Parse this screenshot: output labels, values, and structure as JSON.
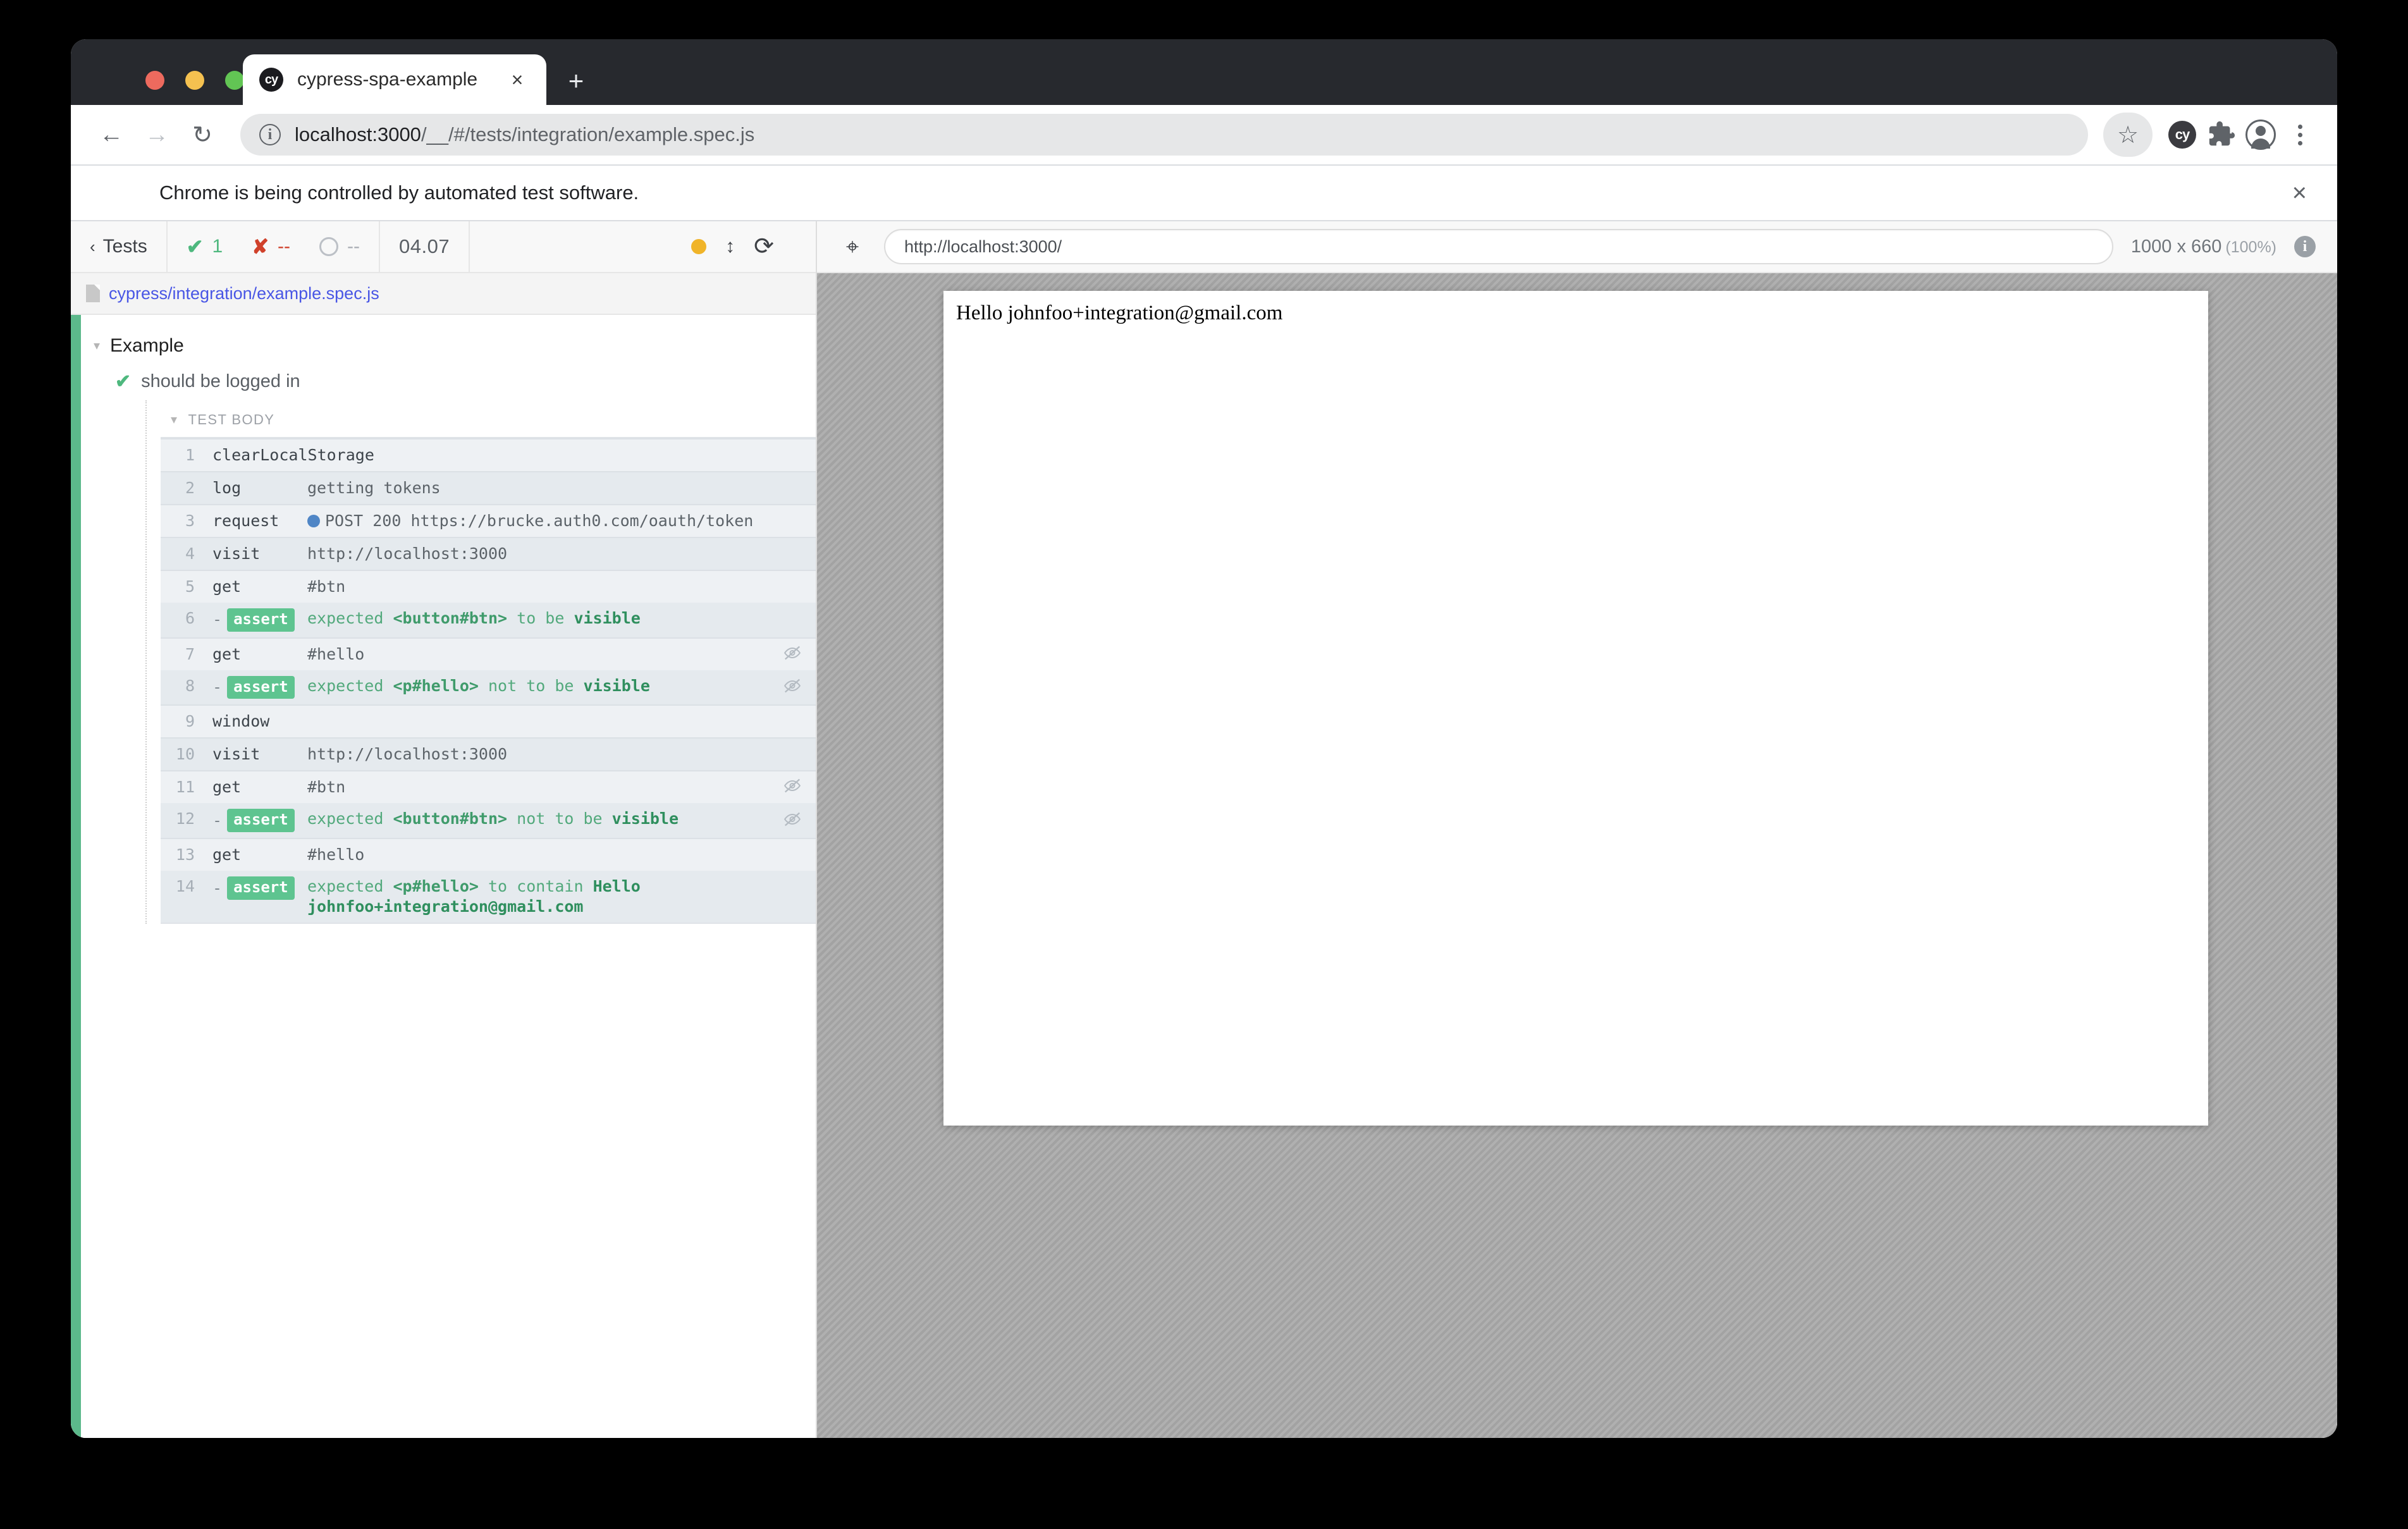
{
  "browser": {
    "tab": {
      "title": "cypress-spa-example",
      "favicon_text": "cy",
      "close_label": "×"
    },
    "new_tab_label": "+",
    "nav": {
      "back": "←",
      "forward": "→",
      "reload": "↻"
    },
    "omnibox": {
      "url_prefix": "localhost:3000",
      "url_rest": "/__/#/tests/integration/example.spec.js",
      "full_url": "localhost:3000/__/#/tests/integration/example.spec.js",
      "star_label": "☆"
    },
    "extensions": {
      "cypress_label": "cy",
      "puzzle_label": "❖"
    },
    "infobar": {
      "text": "Chrome is being controlled by automated test software.",
      "close_label": "×"
    }
  },
  "reporter": {
    "back_to_tests": "Tests",
    "back_chevron": "‹",
    "stats": {
      "passed_glyph": "✔",
      "passed": "1",
      "failed_glyph": "✘",
      "failed": "--",
      "pending": "--",
      "duration": "04.07"
    },
    "controls": {
      "auto_scroll_label": "●",
      "toggle_arrows": "↕",
      "restart": "⟳"
    },
    "spec_path": "cypress/integration/example.spec.js",
    "suite": {
      "name": "Example",
      "caret": "▾"
    },
    "test": {
      "name": "should be logged in",
      "check": "✔"
    },
    "test_body_label": "TEST BODY",
    "test_body_caret": "▾",
    "commands": [
      {
        "num": "1",
        "method": "clearLocalStorage",
        "message": "",
        "type": "cmd",
        "hidden_eye": false
      },
      {
        "num": "2",
        "method": "log",
        "message": "getting tokens",
        "type": "cmd",
        "hidden_eye": false
      },
      {
        "num": "3",
        "method": "request",
        "message": "POST 200 https://brucke.auth0.com/oauth/token",
        "type": "request",
        "hidden_eye": false
      },
      {
        "num": "4",
        "method": "visit",
        "message": "http://localhost:3000",
        "type": "cmd",
        "hidden_eye": false
      },
      {
        "num": "5",
        "method": "get",
        "message": "#btn",
        "type": "cmd",
        "hidden_eye": false
      },
      {
        "num": "6",
        "method": "assert",
        "message": "expected <button#btn> to be visible",
        "type": "assert",
        "hidden_eye": false,
        "parts": [
          {
            "t": "expected ",
            "k": "plain"
          },
          {
            "t": "<button#btn>",
            "k": "sel"
          },
          {
            "t": " to be ",
            "k": "plain"
          },
          {
            "t": "visible",
            "k": "strong"
          }
        ]
      },
      {
        "num": "7",
        "method": "get",
        "message": "#hello",
        "type": "cmd",
        "hidden_eye": true
      },
      {
        "num": "8",
        "method": "assert",
        "message": "expected <p#hello> not to be visible",
        "type": "assert",
        "hidden_eye": true,
        "parts": [
          {
            "t": "expected ",
            "k": "plain"
          },
          {
            "t": "<p#hello>",
            "k": "sel"
          },
          {
            "t": " not to be ",
            "k": "plain"
          },
          {
            "t": "visible",
            "k": "strong"
          }
        ]
      },
      {
        "num": "9",
        "method": "window",
        "message": "",
        "type": "cmd",
        "hidden_eye": false
      },
      {
        "num": "10",
        "method": "visit",
        "message": "http://localhost:3000",
        "type": "cmd",
        "hidden_eye": false
      },
      {
        "num": "11",
        "method": "get",
        "message": "#btn",
        "type": "cmd",
        "hidden_eye": true
      },
      {
        "num": "12",
        "method": "assert",
        "message": "expected <button#btn> not to be visible",
        "type": "assert",
        "hidden_eye": true,
        "parts": [
          {
            "t": "expected ",
            "k": "plain"
          },
          {
            "t": "<button#btn>",
            "k": "sel"
          },
          {
            "t": " not to be ",
            "k": "plain"
          },
          {
            "t": "visible",
            "k": "strong"
          }
        ]
      },
      {
        "num": "13",
        "method": "get",
        "message": "#hello",
        "type": "cmd",
        "hidden_eye": false
      },
      {
        "num": "14",
        "method": "assert",
        "message": "expected <p#hello> to contain Hello johnfoo+integration@gmail.com",
        "type": "assert",
        "hidden_eye": false,
        "parts": [
          {
            "t": "expected ",
            "k": "plain"
          },
          {
            "t": "<p#hello>",
            "k": "sel"
          },
          {
            "t": " to contain ",
            "k": "plain"
          },
          {
            "t": "Hello johnfoo+integration@gmail.com",
            "k": "strong"
          }
        ]
      }
    ],
    "assert_badge_label": "assert",
    "assert_dash": "-",
    "eye_off_glyph": "🚫"
  },
  "aut": {
    "selector_playground_glyph": "⌖",
    "url": "http://localhost:3000/",
    "viewport": "1000 x 660",
    "scale": "(100%)",
    "info_glyph": "i",
    "page_text": "Hello johnfoo+integration@gmail.com"
  },
  "colors": {
    "pass_green": "#5cb98b",
    "assert_badge": "#5ec490",
    "fail_red": "#d0412b",
    "link_blue": "#4956e5",
    "request_dot": "#4f86c6",
    "auto_scroll_amber": "#f0b429",
    "tab_strip": "#27292e"
  }
}
